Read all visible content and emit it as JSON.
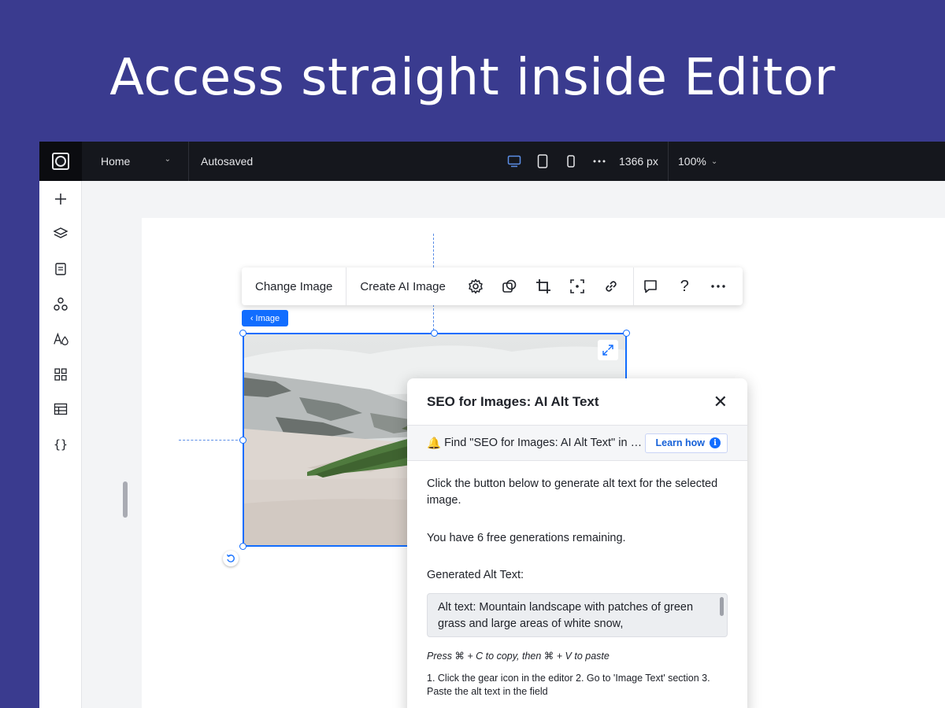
{
  "headline": "Access straight inside Editor",
  "topbar": {
    "page_name": "Home",
    "status": "Autosaved",
    "canvas_width": "1366 px",
    "zoom": "100%",
    "devices": [
      "desktop-icon",
      "tablet-icon",
      "mobile-icon",
      "more-icon"
    ]
  },
  "rail": {
    "icons": [
      "plus-icon",
      "layers-icon",
      "pages-icon",
      "apps-icon",
      "design-icon",
      "widgets-icon",
      "table-icon",
      "code-icon"
    ]
  },
  "toolbar": {
    "change_image": "Change Image",
    "create_ai_image": "Create AI Image",
    "icons": [
      "gear-icon",
      "mask-icon",
      "crop-icon",
      "focus-icon",
      "link-icon",
      "comment-icon",
      "help-icon",
      "more-icon"
    ],
    "help_glyph": "?"
  },
  "image_tag": {
    "chevron": "‹",
    "label": "Image"
  },
  "panel": {
    "title": "SEO for Images: AI Alt Text",
    "close": "✕",
    "notice_emoji": "🔔",
    "notice": "Find \"SEO for Images: AI Alt Text\" in your Apps",
    "learn_how": "Learn how",
    "info_glyph": "i",
    "intro": "Click the button below to generate alt text for the selected image.",
    "remaining": "You have 6 free generations remaining.",
    "generated_label": "Generated Alt Text:",
    "alt_text": "Alt text: Mountain landscape with patches of green grass and large areas of white snow,",
    "hint": "Press ⌘ + C to copy, then ⌘ + V to paste",
    "steps": "1. Click the gear icon in the editor 2. Go to 'Image Text' section 3. Paste the alt text in the field"
  },
  "colors": {
    "background": "#3a3b8f",
    "topbar": "#15171d",
    "accent": "#116dff"
  }
}
